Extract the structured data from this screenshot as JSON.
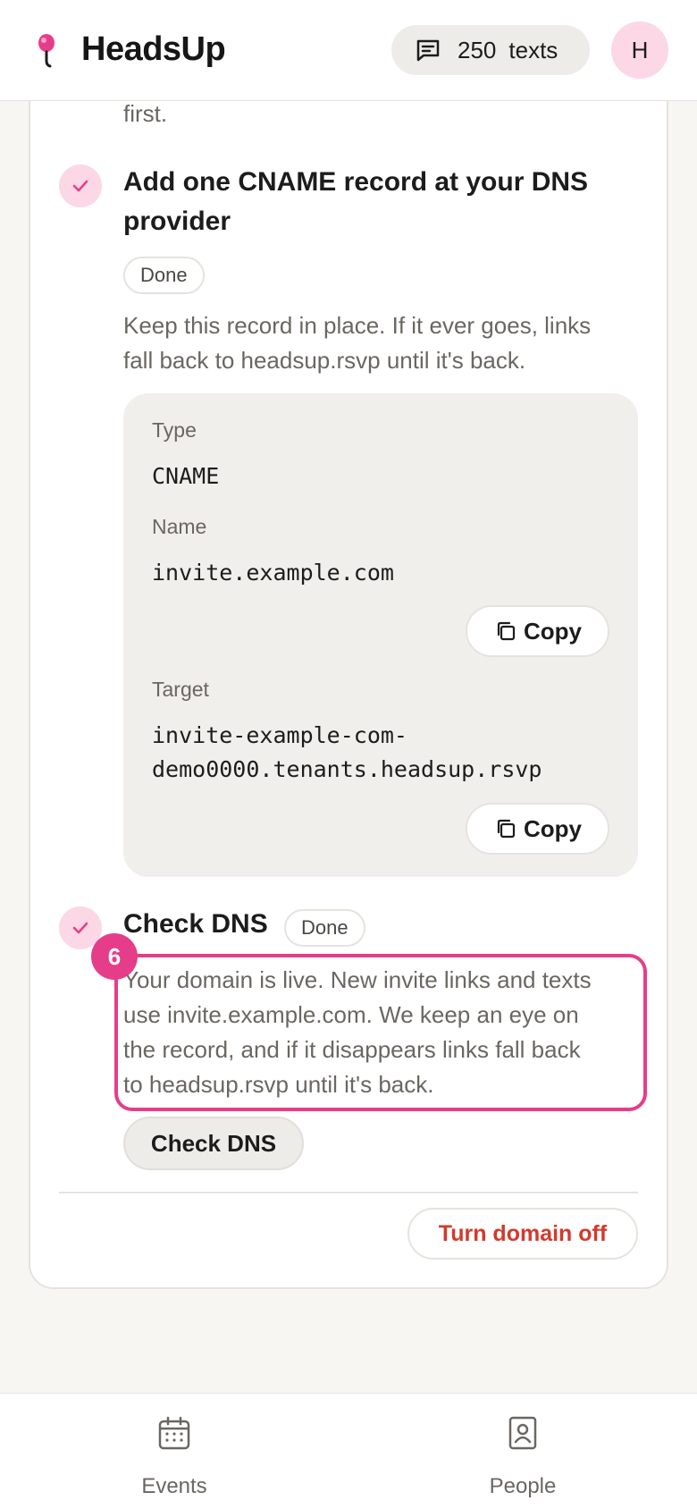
{
  "header": {
    "app_name": "HeadsUp",
    "texts_count": "250",
    "texts_label": "texts",
    "avatar_initial": "H",
    "accent_color": "#e63d8a"
  },
  "steps": {
    "previous_tail": "first.",
    "cname_step": {
      "title_line1": "Add one CNAME record at your DNS",
      "title_line2": "provider",
      "status": "Done",
      "desc_line1": "Keep this record in place. If it ever goes, links",
      "desc_line2": "fall back to headsup.rsvp until it's back.",
      "record": {
        "type_label": "Type",
        "type_value": "CNAME",
        "name_label": "Name",
        "name_value": "invite.example.com",
        "target_label": "Target",
        "target_value_line1": "invite-example-com-",
        "target_value_line2": "demo0000.tenants.headsup.rsvp",
        "copy_label": "Copy"
      }
    },
    "check_step": {
      "title": "Check DNS",
      "status": "Done",
      "marker": "6",
      "desc_line1": "Your domain is live. New invite links and texts",
      "desc_line2": "use invite.example.com. We keep an eye on",
      "desc_line3": "the record, and if it disappears links fall back",
      "desc_line4": "to headsup.rsvp until it's back.",
      "button_label": "Check DNS"
    }
  },
  "footer_actions": {
    "turn_off_label": "Turn domain off"
  },
  "bottom_nav": {
    "items": [
      {
        "label": "Events",
        "icon": "calendar-icon"
      },
      {
        "label": "People",
        "icon": "contact-book-icon"
      }
    ]
  }
}
